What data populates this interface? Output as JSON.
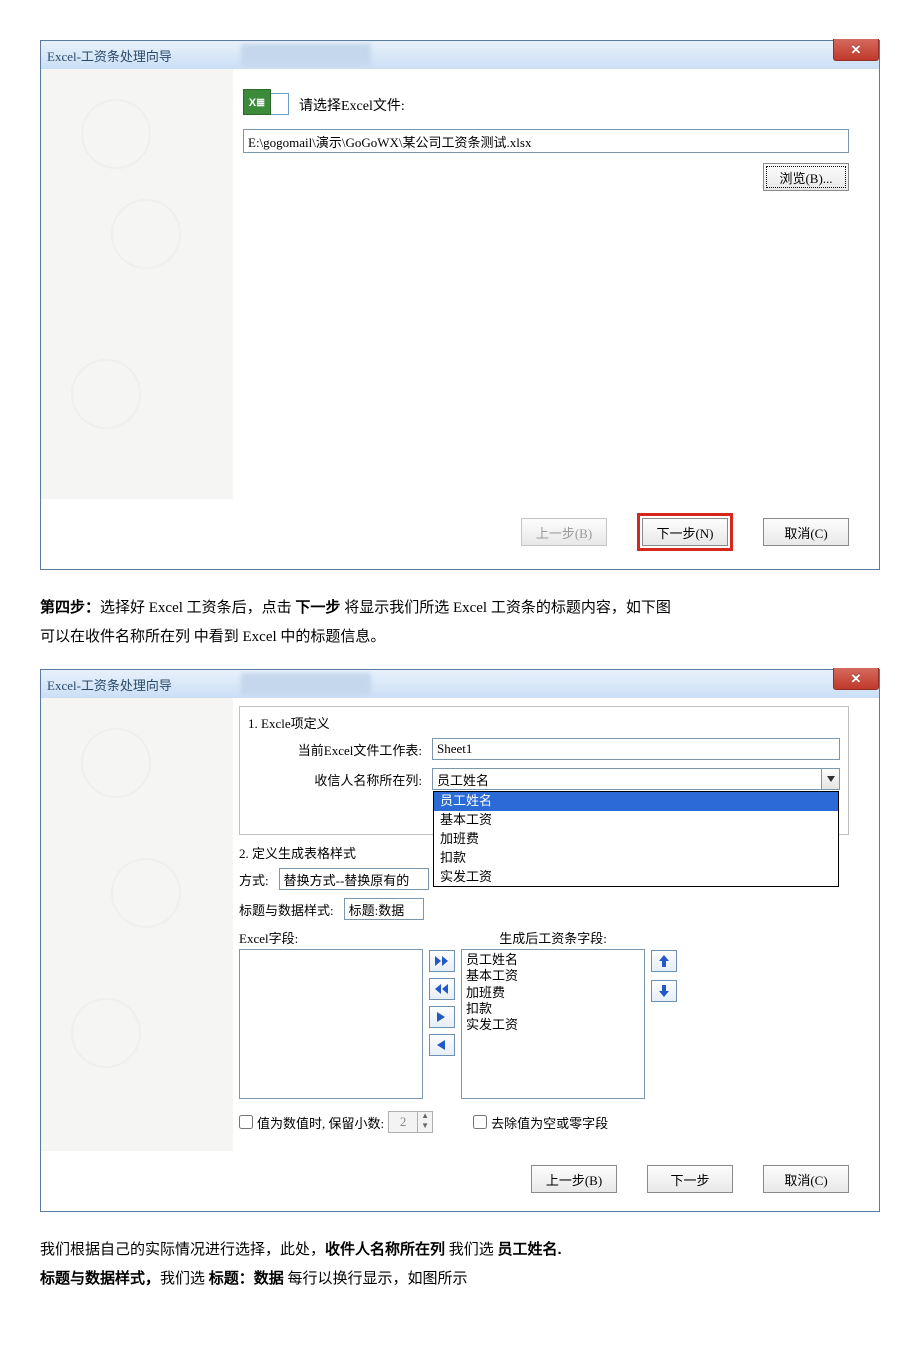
{
  "dialog1": {
    "title": "Excel-工资条处理向导",
    "select_label": "请选择Excel文件:",
    "file_path": "E:\\gogomail\\演示\\GoGoWX\\某公司工资条测试.xlsx",
    "browse": "浏览(B)...",
    "prev": "上一步(B)",
    "next": "下一步(N)",
    "cancel": "取消(C)"
  },
  "step4_text": {
    "prefix": "第四步：",
    "l1a": "选择好 Excel 工资条后，点击 ",
    "l1b": "下一步",
    "l1c": "  将显示我们所选 Excel 工资条的标题内容，如下图",
    "l2": "可以在收件名称所在列  中看到 Excel 中的标题信息。"
  },
  "dialog2": {
    "title": "Excel-工资条处理向导",
    "g1_title": "1. Excle项定义",
    "sheet_label": "当前Excel文件工作表:",
    "sheet_value": "Sheet1",
    "namecol_label": "收信人名称所在列:",
    "namecol_value": "员工姓名",
    "dropdown": [
      "员工姓名",
      "基本工资",
      "加班费",
      "扣款",
      "实发工资"
    ],
    "g2_title": "2. 定义生成表格样式",
    "mode_label": "方式:",
    "mode_value": "替换方式--替换原有的",
    "style_label": "标题与数据样式:",
    "style_value": "标题:数据",
    "excel_fields_label": "Excel字段:",
    "gen_fields_label": "生成后工资条字段:",
    "gen_fields": [
      "员工姓名",
      "基本工资",
      "加班费",
      "扣款",
      "实发工资"
    ],
    "chk_decimal": "值为数值时, 保留小数:",
    "decimal_val": "2",
    "chk_remove": "去除值为空或零字段",
    "prev": "上一步(B)",
    "next": "下一步",
    "cancel": "取消(C)"
  },
  "footer_text": {
    "l1a": "我们根据自己的实际情况进行选择，此处，",
    "l1b": "收件人名称所在列",
    "l1c": "  我们选 ",
    "l1d": "员工姓名.",
    "l2a": "标题与数据样式，",
    "l2b": "我们选  ",
    "l2c": "标题：数据",
    "l2d": "   每行以换行显示，如图所示"
  }
}
